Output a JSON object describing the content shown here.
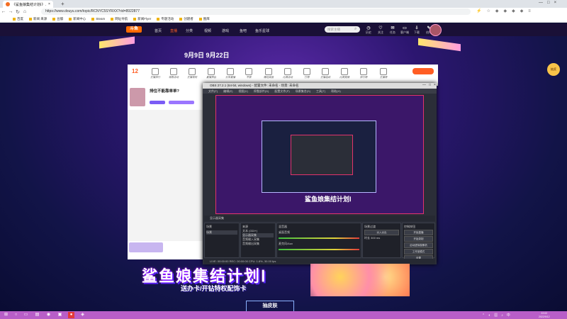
{
  "browser": {
    "tab_title": "《鲨鱼娘集结计划Ⅰ》...",
    "new_tab": "+",
    "url": "https://www.douyu.com/topic/RCNYC5SYRXX?rid=8922877",
    "nav": {
      "back": "←",
      "forward": "→",
      "reload": "↻",
      "home": "⌂"
    },
    "bookmarks": [
      "百度",
      "新闻 来源",
      "豆瓣",
      "新闻中心",
      "Steam",
      "网址导航",
      "新闻Flyer",
      "专题活动",
      "创建者",
      "图库"
    ]
  },
  "douyu": {
    "logo": "斗鱼",
    "nav": [
      "首页",
      "直播",
      "分类",
      "视频",
      "游戏",
      "鱼吧",
      "鱼乐星球"
    ],
    "active_nav": "直播",
    "search_placeholder": "搜索主播",
    "header_icons": [
      "历史",
      "关注",
      "任务",
      "客户端",
      "下载",
      "创作"
    ],
    "date_banner": "9月9日  9月22日",
    "panel_count": "12",
    "panel_items": [
      "主播排行",
      "观看活动",
      "主播规则",
      "直播预告",
      "分享直播",
      "不限",
      "赠送奖励",
      "比赛活动",
      "打榜",
      "主播连线",
      "比赛竞猜",
      "排行榜",
      "主播榜",
      "弹幕互动",
      "礼物"
    ],
    "room_title": "排位不能靠单单?",
    "bottom_title": "鲨鱼娘集结计划Ⅰ",
    "bottom_sub": "送办卡/开钻特权配饰卡",
    "skin_button": "抽皮肤",
    "side_button": "抽奖"
  },
  "obs": {
    "title": "OBS 27.2.1 (64-bit, windows) - 配置文件: 未命名 - 场景: 未命名",
    "menu": [
      "文件(F)",
      "编辑(E)",
      "视图(V)",
      "停靠部件(D)",
      "配置文件(P)",
      "场景集合(S)",
      "工具(T)",
      "帮助(H)"
    ],
    "toolbar": "显示器采集",
    "dock_titles": [
      "场景",
      "来源",
      "混音器",
      "场景过渡",
      "控制按钮"
    ],
    "scene": "场景",
    "sources": [
      "文本 (GDI+)",
      "显示器采集",
      "音频输入采集",
      "音频输出采集"
    ],
    "mixer_tracks": [
      "桌面音频",
      "麦克风/Aux"
    ],
    "transition": "淡入淡出",
    "duration_label": "时长",
    "duration": "300 ms",
    "controls": [
      "开始直播",
      "开始录制",
      "启动虚拟摄像机",
      "工作室模式",
      "设置",
      "退出"
    ],
    "status": "LIVE: 00:00:00   REC: 00:00:00   CPU: 1.8%, 30.00 fps"
  },
  "taskbar": {
    "clock_time": "22:02",
    "clock_date": "2022/9/12"
  }
}
